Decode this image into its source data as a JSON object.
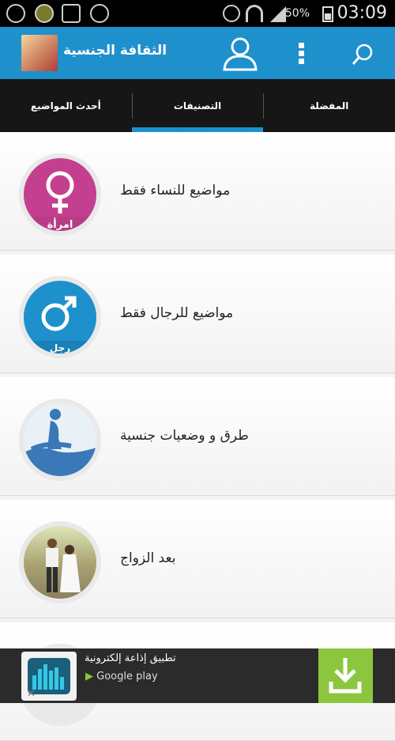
{
  "status_bar": {
    "time": "03:09",
    "battery": "50%"
  },
  "app_bar": {
    "title": "الثقافة الجنسية"
  },
  "tabs": [
    {
      "label": "أحدث المواضيع",
      "active": false
    },
    {
      "label": "التصنيفات",
      "active": true
    },
    {
      "label": "المفضلة",
      "active": false
    }
  ],
  "categories": [
    {
      "label": "مواضيع للنساء فقط",
      "badge": "امرأة",
      "color": "#c43f8f",
      "icon": "female-symbol-icon"
    },
    {
      "label": "مواضيع للرجال فقط",
      "badge": "رجل",
      "color": "#1e90cc",
      "icon": "male-symbol-icon"
    },
    {
      "label": "طرق و وضعيات جنسية",
      "badge": "",
      "color": "#3a78b8",
      "icon": "couple-silhouette-icon"
    },
    {
      "label": "بعد الزواج",
      "badge": "",
      "color": "#a8a070",
      "icon": "wedding-couple-photo"
    }
  ],
  "ad": {
    "title": "تطبيق إذاعة إلكترونية",
    "store": "Google play",
    "accent": "#8cc63f"
  }
}
